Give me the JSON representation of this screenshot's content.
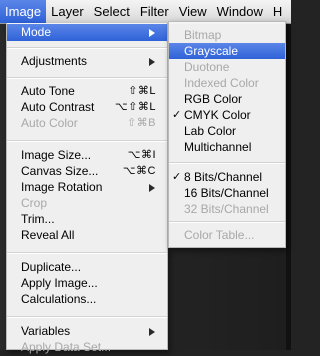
{
  "menubar": {
    "items": [
      "Image",
      "Layer",
      "Select",
      "Filter",
      "View",
      "Window",
      "H"
    ],
    "active_index": 0
  },
  "image_menu": {
    "mode": "Mode",
    "adjustments": "Adjustments",
    "auto_tone": {
      "label": "Auto Tone",
      "shortcut": "⇧⌘L"
    },
    "auto_contrast": {
      "label": "Auto Contrast",
      "shortcut": "⌥⇧⌘L"
    },
    "auto_color": {
      "label": "Auto Color",
      "shortcut": "⇧⌘B"
    },
    "image_size": {
      "label": "Image Size...",
      "shortcut": "⌥⌘I"
    },
    "canvas_size": {
      "label": "Canvas Size...",
      "shortcut": "⌥⌘C"
    },
    "image_rotation": "Image Rotation",
    "crop": "Crop",
    "trim": "Trim...",
    "reveal_all": "Reveal All",
    "duplicate": "Duplicate...",
    "apply_image": "Apply Image...",
    "calculations": "Calculations...",
    "variables": "Variables",
    "apply_data_set": "Apply Data Set..."
  },
  "mode_submenu": {
    "bitmap": "Bitmap",
    "grayscale": "Grayscale",
    "duotone": "Duotone",
    "indexed_color": "Indexed Color",
    "rgb_color": "RGB Color",
    "cmyk_color": "CMYK Color",
    "lab_color": "Lab Color",
    "multichannel": "Multichannel",
    "bits8": "8 Bits/Channel",
    "bits16": "16 Bits/Channel",
    "bits32": "32 Bits/Channel",
    "color_table": "Color Table...",
    "checkmark": "✓"
  }
}
